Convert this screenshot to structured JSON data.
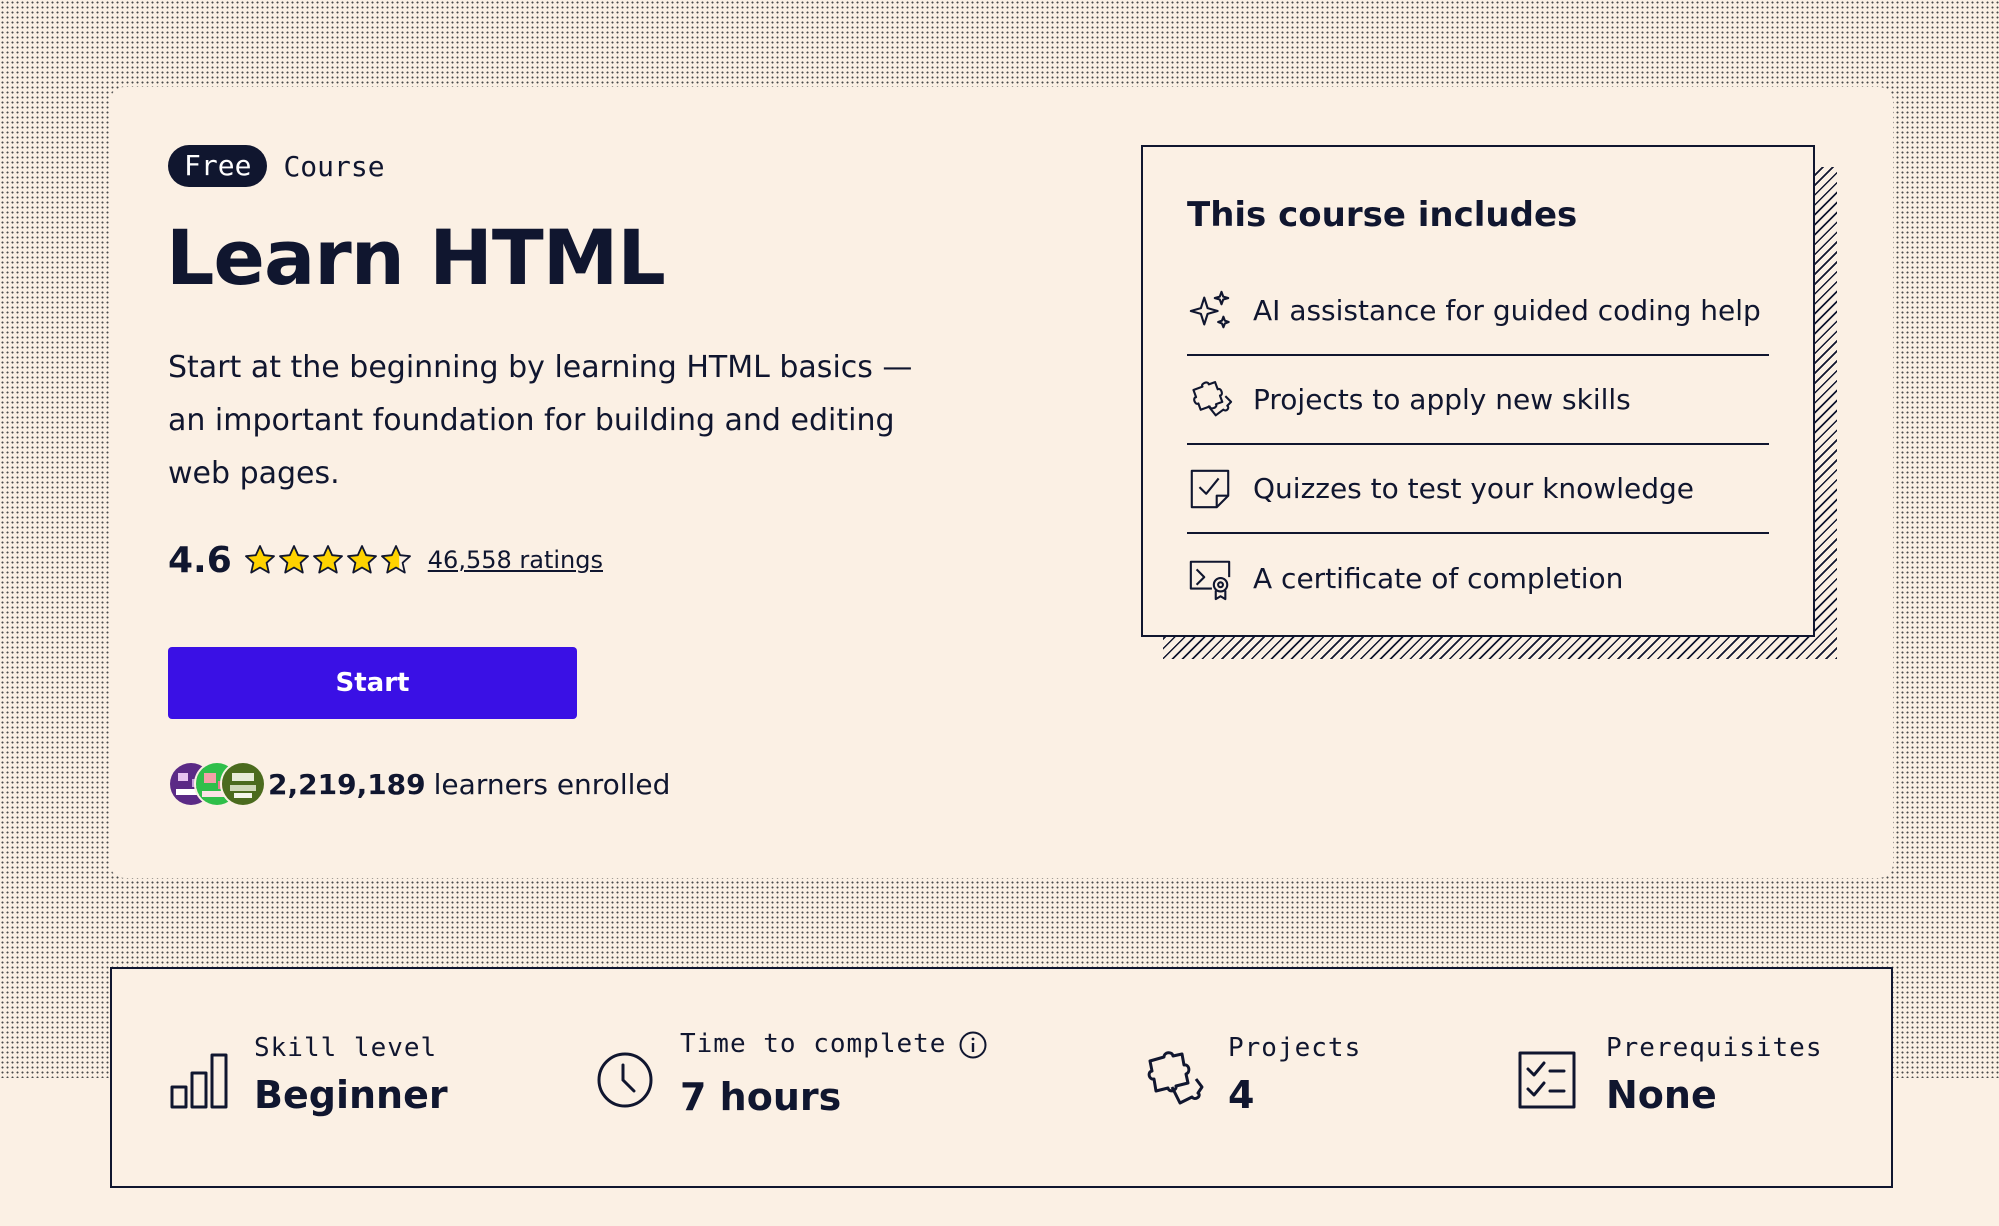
{
  "hero": {
    "badge": "Free",
    "badge_suffix": "Course",
    "title": "Learn HTML",
    "description": "Start at the beginning by learning HTML basics — an important foundation for building and editing web pages.",
    "rating": "4.6",
    "rating_value": 4.6,
    "rating_max": 5,
    "ratings_link": "46,558 ratings",
    "start_label": "Start",
    "enrolled_count": "2,219,189",
    "enrolled_text": "learners enrolled"
  },
  "includes": {
    "title": "This course includes",
    "items": [
      {
        "icon": "sparkle-icon",
        "label": "AI assistance for guided coding help"
      },
      {
        "icon": "puzzle-icon",
        "label": "Projects to apply new skills"
      },
      {
        "icon": "quiz-checkbox-icon",
        "label": "Quizzes to test your knowledge"
      },
      {
        "icon": "certificate-icon",
        "label": "A certificate of completion"
      }
    ]
  },
  "stats": [
    {
      "icon": "bar-chart-icon",
      "label": "Skill level",
      "value": "Beginner"
    },
    {
      "icon": "clock-icon",
      "label": "Time to complete",
      "value": "7 hours",
      "info_icon": "info-icon"
    },
    {
      "icon": "puzzle-icon",
      "label": "Projects",
      "value": "4"
    },
    {
      "icon": "checklist-icon",
      "label": "Prerequisites",
      "value": "None"
    }
  ],
  "colors": {
    "background": "#fbf0e4",
    "text": "#10162f",
    "primary_button": "#3a10e5",
    "star": "#ffd300"
  }
}
